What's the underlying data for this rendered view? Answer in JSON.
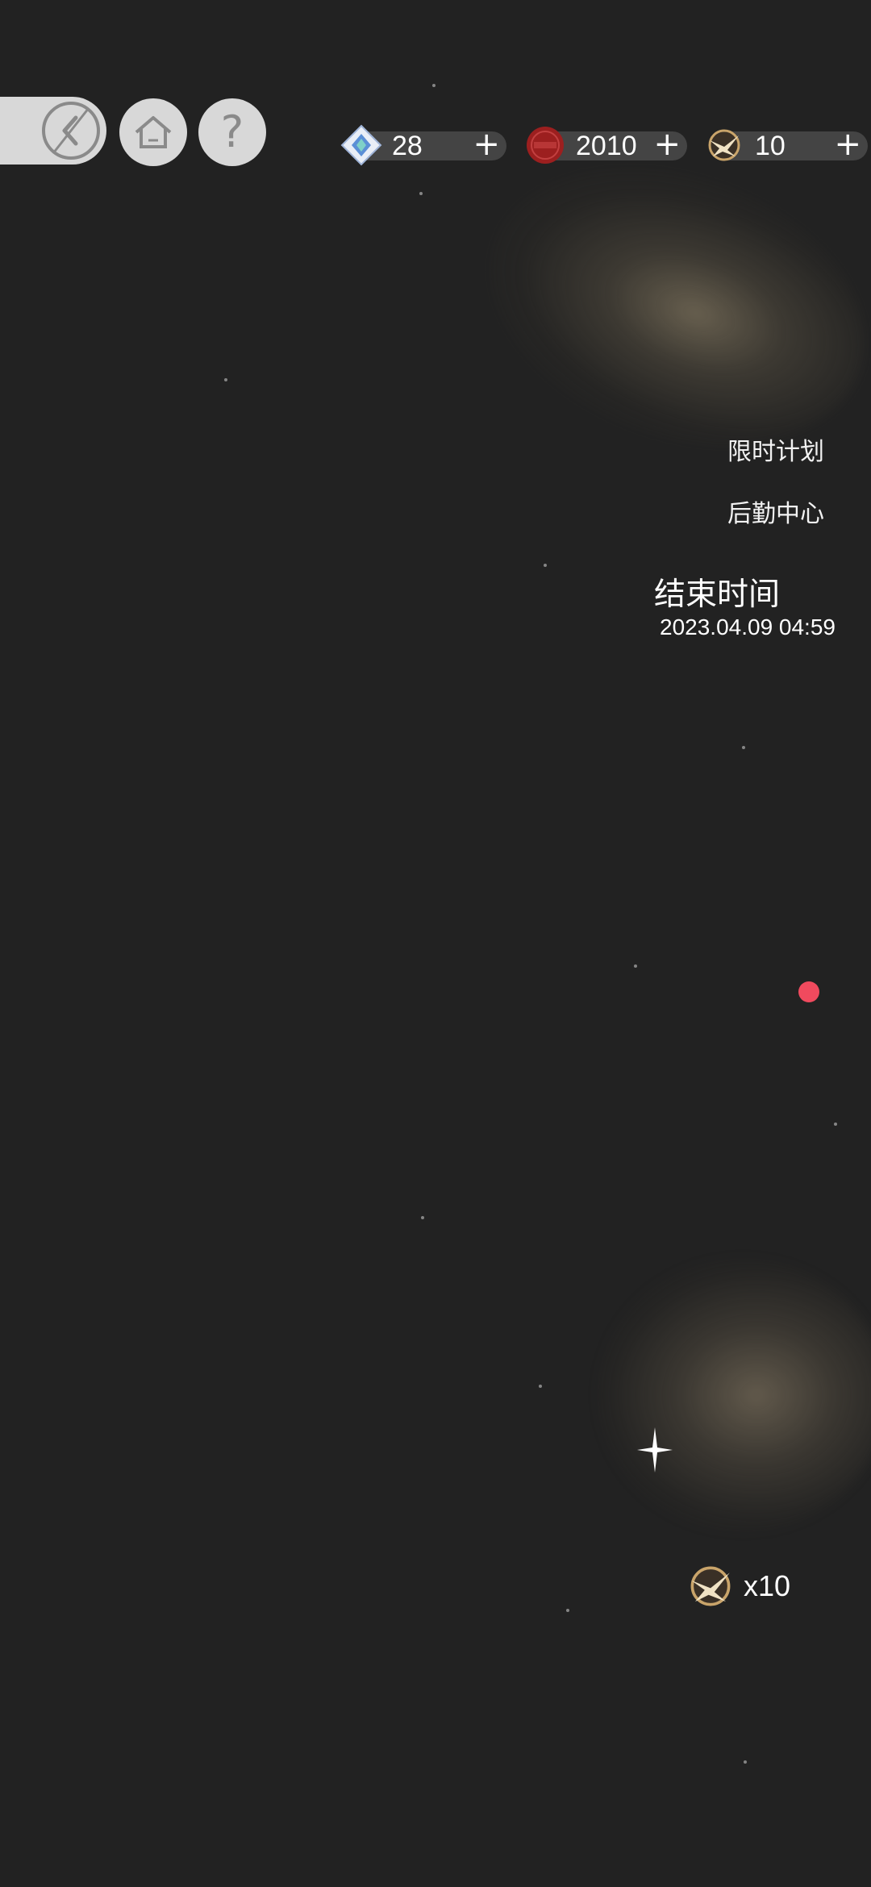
{
  "nav": {
    "back_icon": "back-arrow-icon",
    "home_icon": "home-icon",
    "help_label": "?"
  },
  "currencies": [
    {
      "icon": "diamond-gem-icon",
      "value": "28",
      "add": "+"
    },
    {
      "icon": "red-coin-icon",
      "value": "2010",
      "add": "+"
    },
    {
      "icon": "bird-emblem-icon",
      "value": "10",
      "add": "+"
    }
  ],
  "menu": {
    "limited_plan": "限时计划",
    "logistics_center": "后勤中心"
  },
  "event": {
    "end_label": "结束时间",
    "end_time": "2023.04.09 04:59"
  },
  "reward": {
    "icon": "bird-emblem-icon",
    "count": "x10"
  },
  "colors": {
    "background": "#222222",
    "button_gray": "#d8d8d8",
    "notification": "#f04a5e"
  }
}
